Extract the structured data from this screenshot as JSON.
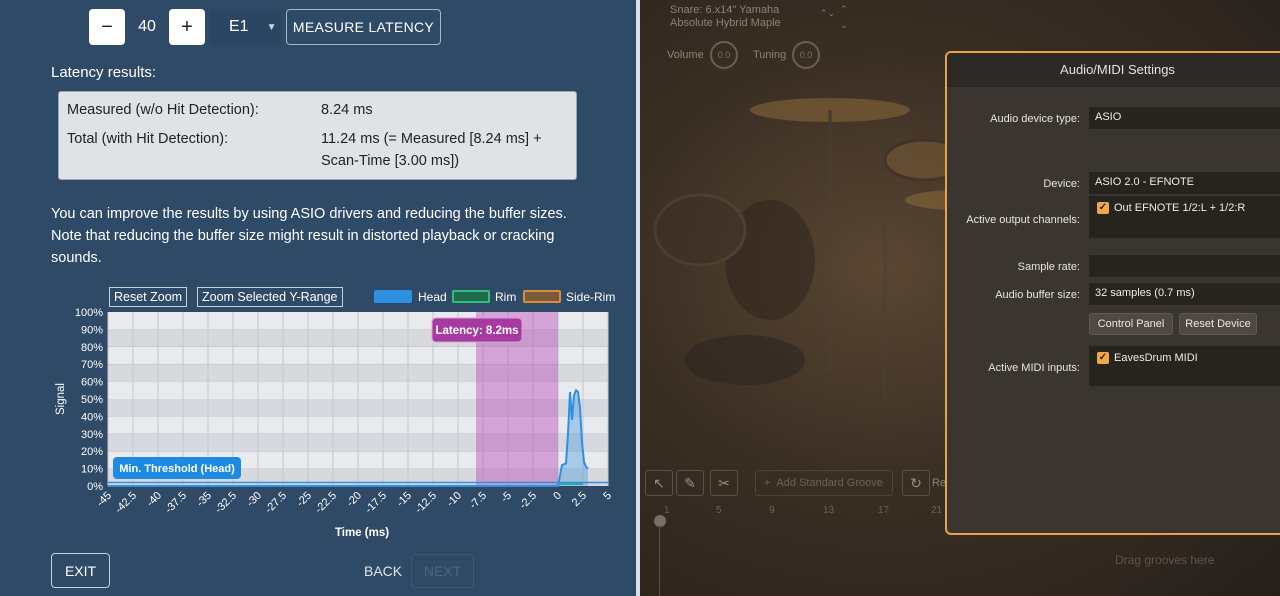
{
  "latency_tool": {
    "decrement_label": "−",
    "value": "40",
    "increment_label": "+",
    "pad_select": "E1",
    "measure_button": "MEASURE LATENCY",
    "results_heading": "Latency results:",
    "measured_label": "Measured (w/o Hit Detection):",
    "measured_value": "8.24 ms",
    "total_label": "Total (with Hit Detection):",
    "total_value_line1": "11.24 ms (= Measured [8.24 ms] +",
    "total_value_line2": "Scan-Time [3.00 ms])",
    "info_text": "You can improve the results by using ASIO drivers and reducing the buffer sizes. Note that reducing the buffer size might result in distorted playback or cracking sounds.",
    "reset_zoom": "Reset Zoom",
    "zoom_selected": "Zoom Selected Y-Range",
    "exit_button": "EXIT",
    "back_button": "BACK",
    "next_button": "NEXT"
  },
  "chart_data": {
    "type": "line",
    "xlabel": "Time (ms)",
    "ylabel": "Signal",
    "xlim": [
      -45,
      5
    ],
    "ylim": [
      0,
      100
    ],
    "x_ticks": [
      "-45",
      "-42.5",
      "-40",
      "-37.5",
      "-35",
      "-32.5",
      "-30",
      "-27.5",
      "-25",
      "-22.5",
      "-20",
      "-17.5",
      "-15",
      "-12.5",
      "-10",
      "-7.5",
      "-5",
      "-2.5",
      "0",
      "2.5",
      "5"
    ],
    "y_ticks": [
      "0%",
      "10%",
      "20%",
      "30%",
      "40%",
      "50%",
      "60%",
      "70%",
      "80%",
      "90%",
      "100%"
    ],
    "legend": [
      {
        "name": "Head",
        "color": "#2f8fe0"
      },
      {
        "name": "Rim",
        "color": "#2fbf7a"
      },
      {
        "name": "Side-Rim",
        "color": "#d98c3a"
      }
    ],
    "series": [
      {
        "name": "Head",
        "color": "#2f8fe0",
        "x": [
          -45,
          -0.2,
          0,
          0.4,
          0.8,
          1.0,
          1.2,
          1.4,
          1.6,
          1.8,
          2.0,
          2.2,
          2.4,
          2.6,
          2.8,
          3.0
        ],
        "y": [
          0,
          0,
          0,
          12,
          13,
          30,
          54,
          38,
          52,
          55,
          54,
          45,
          25,
          14,
          11,
          10
        ]
      }
    ],
    "threshold": {
      "label": "Min. Threshold (Head)",
      "value": 2
    },
    "latency_band": {
      "label": "Latency: 8.2ms",
      "from": -8.2,
      "to": 0
    }
  },
  "daw": {
    "snare_line1": "Snare: 6.x14\" Yamaha",
    "snare_line2": "Absolute Hybrid Maple",
    "volume_label": "Volume",
    "volume_value": "0.0",
    "tuning_label": "Tuning",
    "tuning_value": "0.0",
    "add_groove": "Add Standard Groove",
    "partial_btn": "Re",
    "timeline": [
      "1",
      "5",
      "9",
      "13",
      "17",
      "21"
    ],
    "drag_text": "Drag grooves here"
  },
  "audio_settings": {
    "title": "Audio/MIDI Settings",
    "device_type_label": "Audio device type:",
    "device_type_value": "ASIO",
    "device_label": "Device:",
    "device_value": "ASIO 2.0 - EFNOTE",
    "output_label": "Active output channels:",
    "output_value": "Out EFNOTE  1/2:L + 1/2:R",
    "sample_rate_label": "Sample rate:",
    "sample_rate_value": "",
    "buffer_label": "Audio buffer size:",
    "buffer_value": "32 samples (0.7 ms)",
    "control_panel": "Control Panel",
    "reset_device": "Reset Device",
    "midi_label": "Active MIDI inputs:",
    "midi_value": "EavesDrum MIDI"
  }
}
